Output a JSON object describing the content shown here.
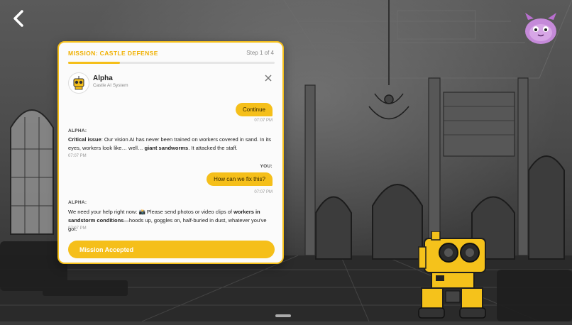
{
  "mission": {
    "title": "MISSION: CASTLE DEFENSE",
    "step": "Step 1 of 4",
    "progress": 0.25
  },
  "agent": {
    "name": "Alpha",
    "subtitle": "Castle AI System"
  },
  "messages": {
    "m1": {
      "text": "Continue",
      "time": "07:07 PM"
    },
    "m2": {
      "sender": "ALPHA:",
      "part1": "Critical issue",
      "part2": ": Our vision AI has never been trained on workers covered in sand. In its eyes, workers look like… well… ",
      "part3": "giant sandworms",
      "part4": ". It attacked the staff.",
      "time": "07:07 PM"
    },
    "m3": {
      "sender": "YOU:",
      "text": "How can we fix this?",
      "time": "07:07 PM"
    },
    "m4": {
      "sender": "ALPHA:",
      "part1": "We need your help right now: 📸 Please send photos or video clips of ",
      "part2": "workers in sandstorm conditions",
      "part3": "—hoods up, goggles on, half-buried in dust, whatever you've got.",
      "time": "07:07 PM"
    }
  },
  "actions": {
    "accept_label": "Mission Accepted"
  },
  "colors": {
    "accent": "#f5bf1a",
    "mission_title": "#f0b000"
  },
  "icons": {
    "back": "chevron-left-icon",
    "close": "close-icon",
    "mascot": "purple-fluffy-creature",
    "robot": "yellow-robot"
  }
}
